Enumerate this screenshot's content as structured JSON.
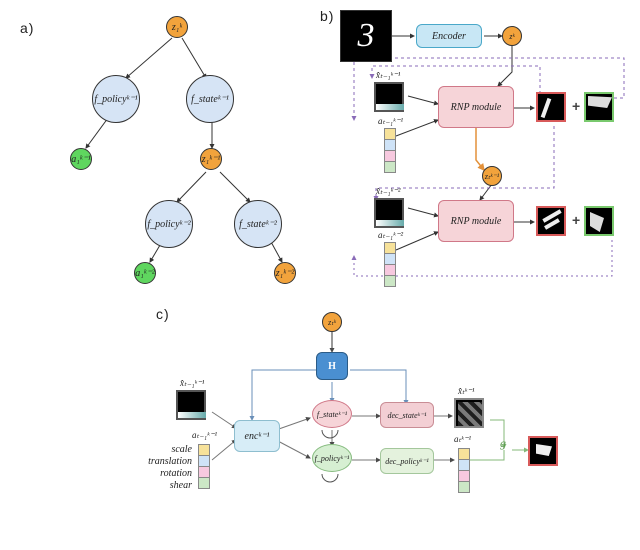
{
  "panels": {
    "a": "a)",
    "b": "b)",
    "c": "c)"
  },
  "panel_a": {
    "z_k_1": "z₁ᵏ",
    "f_policy_k1": "f_policyᵏ⁻¹",
    "f_state_k1": "f_stateᵏ⁻¹",
    "a_k1": "a₁ᵏ⁻¹",
    "z_k1": "z₁ᵏ⁻¹",
    "f_policy_k2": "f_policyᵏ⁻²",
    "f_state_k2": "f_stateᵏ⁻²",
    "a_k2": "a₁ᵏ⁻²",
    "z_k2": "z₁ᵏ⁻²"
  },
  "panel_b": {
    "encoder": "Encoder",
    "z_k": "zᵏ",
    "rnp1": "RNP module",
    "rnp2": "RNP module",
    "x_hat_k1": "x̂ₜ₋₁ᵏ⁻¹",
    "a_k1": "aₜ₋₁ᵏ⁻¹",
    "z_km1": "zₜᵏ⁻¹",
    "x_hat_k2": "x̂ₜ₋₁ᵏ⁻²",
    "a_k2": "aₜ₋₁ᵏ⁻²",
    "plus": "+"
  },
  "panel_c": {
    "z_k": "zₜᵏ",
    "H": "H",
    "enc": "encᵏ⁻¹",
    "f_state": "f_stateᵏ⁻¹",
    "f_policy": "f_policyᵏ⁻¹",
    "dec_state": "dec_stateᵏ⁻¹",
    "dec_policy": "dec_policyᵏ⁻¹",
    "x_hat_in": "x̂ₜ₋₁ᵏ⁻¹",
    "x_hat_out": "x̂ₜᵏ⁻¹",
    "a_in": "aₜ₋₁ᵏ⁻¹",
    "a_out": "aₜᵏ⁻¹",
    "g": "g",
    "params": {
      "scale": "scale",
      "translation": "translation",
      "rotation": "rotation",
      "shear": "shear"
    }
  },
  "colors": {
    "orange": "#f2a33c",
    "green": "#5fd65f",
    "blue": "#d6e4f5",
    "encoder": "#c8e7f5",
    "rnp": "#f6d4d8",
    "H": "#4a8fd1"
  }
}
